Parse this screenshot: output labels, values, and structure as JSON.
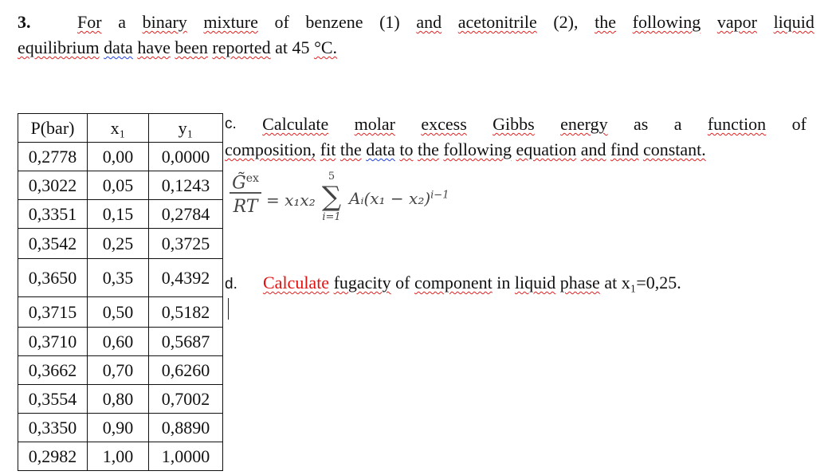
{
  "question": {
    "number": "3.",
    "line1_words": [
      "For",
      "a",
      "binary",
      "mixture",
      "of",
      "benzene",
      "(1)",
      "and",
      "acetonitrile",
      "(2),",
      "the",
      "following",
      "vapor",
      "liquid"
    ],
    "line2": {
      "w1": "equilibrium",
      "w2": "data",
      "w3": "have",
      "w4": "been",
      "w5": "reported",
      "w6": "at 45",
      "w7": "°C."
    }
  },
  "table": {
    "headers": [
      "P(bar)",
      "x₁",
      "y₁"
    ],
    "rows": [
      [
        "0,2778",
        "0,00",
        "0,0000"
      ],
      [
        "0,3022",
        "0,05",
        "0,1243"
      ],
      [
        "0,3351",
        "0,15",
        "0,2784"
      ],
      [
        "0,3542",
        "0,25",
        "0,3725"
      ],
      [
        "0,3650",
        "0,35",
        "0,4392"
      ],
      [
        "0,3715",
        "0,50",
        "0,5182"
      ],
      [
        "0,3710",
        "0,60",
        "0,5687"
      ],
      [
        "0,3662",
        "0,70",
        "0,6260"
      ],
      [
        "0,3554",
        "0,80",
        "0,7002"
      ],
      [
        "0,3350",
        "0,90",
        "0,8890"
      ],
      [
        "0,2982",
        "1,00",
        "1,0000"
      ]
    ]
  },
  "part_c": {
    "label": "c.",
    "line1_words": [
      "Calculate",
      "molar",
      "excess",
      "Gibbs",
      "energy",
      "as",
      "a",
      "function",
      "of"
    ],
    "line2": {
      "w1": "composition,",
      "w2": "fit",
      "w3": "the",
      "w4": "data",
      "w5": "to",
      "w6": "the",
      "w7": "following",
      "w8": "equation",
      "w9": "and",
      "w10": "find",
      "w11": "constant."
    },
    "equation": {
      "numerator": "G̃",
      "numerator_sup": "ex",
      "denominator": "RT",
      "middle": "= x₁x₂",
      "sum_upper": "5",
      "sum_symbol": "∑",
      "sum_lower": "i=1",
      "tail": "Aᵢ(x₁ − x₂)",
      "tail_sup": "i−1"
    }
  },
  "part_d": {
    "label": "d.",
    "highlight": "Calculate",
    "w1": "fugacity",
    "w2": "of",
    "w3": "component",
    "w4": "in",
    "w5": "liquid",
    "w6": "phase",
    "w7": "at x₁=0,25."
  },
  "colors": {
    "highlight_red": "#e01010",
    "spell_underline": "#e02020",
    "grammar_underline": "#2040e0"
  }
}
